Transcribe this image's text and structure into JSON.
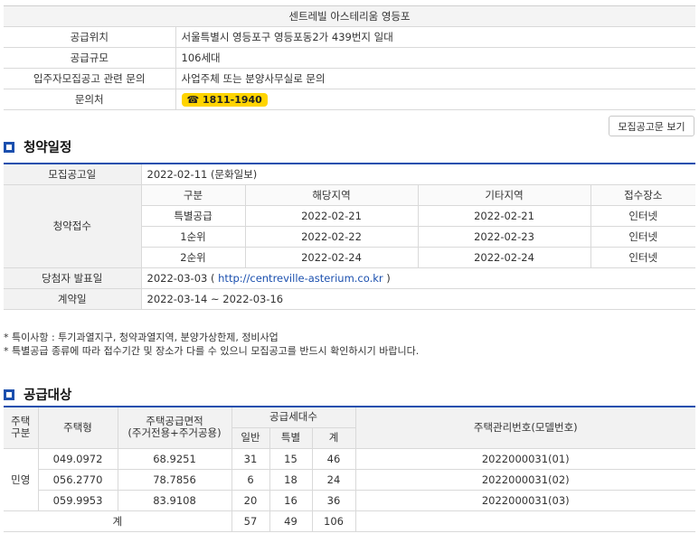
{
  "info": {
    "title": "센트레빌 아스테리움 영등포",
    "rows": [
      {
        "label": "공급위치",
        "value": "서울특별시 영등포구 영등포동2가 439번지 일대"
      },
      {
        "label": "공급규모",
        "value": "106세대"
      },
      {
        "label": "입주자모집공고 관련 문의",
        "value": "사업주체 또는 분양사무실로 문의"
      }
    ],
    "contact_label": "문의처",
    "phone": "☎ 1811-1940"
  },
  "notice_button": "모집공고문 보기",
  "schedule": {
    "section_title": "청약일정",
    "announce_label": "모집공고일",
    "announce_value": "2022-02-11 (문화일보)",
    "apply_label": "청약접수",
    "apply_headers": [
      "구분",
      "해당지역",
      "기타지역",
      "접수장소"
    ],
    "apply_rows": [
      [
        "특별공급",
        "2022-02-21",
        "2022-02-21",
        "인터넷"
      ],
      [
        "1순위",
        "2022-02-22",
        "2022-02-23",
        "인터넷"
      ],
      [
        "2순위",
        "2022-02-24",
        "2022-02-24",
        "인터넷"
      ]
    ],
    "winner_label": "당첨자 발표일",
    "winner_date": "2022-03-03 (",
    "winner_link": "http://centreville-asterium.co.kr",
    "winner_close": ")",
    "contract_label": "계약일",
    "contract_value": "2022-03-14 ~ 2022-03-16"
  },
  "notes": [
    "* 특이사항 : 투기과열지구, 청약과열지역, 분양가상한제, 정비사업",
    "* 특별공급 종류에 따라 접수기간 및 장소가 다를 수 있으니 모집공고를 반드시 확인하시기 바랍니다."
  ],
  "supply": {
    "section_title": "공급대상",
    "h_type": "주택\n구분",
    "h_model": "주택형",
    "h_area": "주택공급면적\n(주거전용+주거공용)",
    "h_units": "공급세대수",
    "h_general": "일반",
    "h_special": "특별",
    "h_total": "계",
    "h_mgmt": "주택관리번호(모델번호)",
    "house_type": "민영",
    "rows": [
      {
        "model": "049.0972",
        "area": "68.9251",
        "general": "31",
        "special": "15",
        "total": "46",
        "mgmt": "2022000031(01)"
      },
      {
        "model": "056.2770",
        "area": "78.7856",
        "general": "6",
        "special": "18",
        "total": "24",
        "mgmt": "2022000031(02)"
      },
      {
        "model": "059.9953",
        "area": "83.9108",
        "general": "20",
        "special": "16",
        "total": "36",
        "mgmt": "2022000031(03)"
      }
    ],
    "sum_label": "계",
    "sum_general": "57",
    "sum_special": "49",
    "sum_total": "106"
  }
}
